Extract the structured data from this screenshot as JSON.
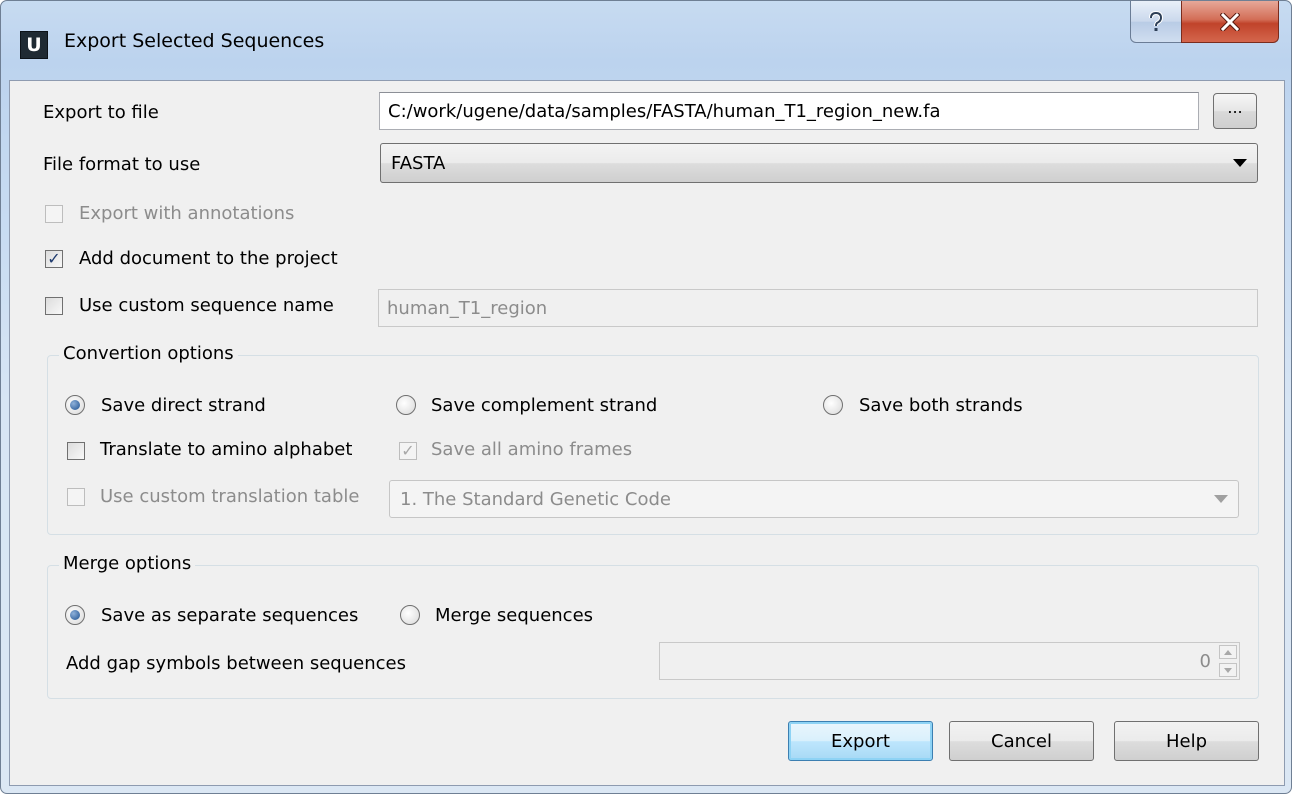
{
  "window": {
    "app_icon_letter": "U",
    "title": "Export Selected Sequences",
    "help_icon": "question-mark-icon",
    "close_icon": "close-x-icon"
  },
  "export_file": {
    "label": "Export to file",
    "value": "C:/work/ugene/data/samples/FASTA/human_T1_region_new.fa",
    "browse_label": "..."
  },
  "file_format": {
    "label": "File format to use",
    "selected": "FASTA"
  },
  "options": {
    "export_annotations": {
      "label": "Export with annotations",
      "checked": false,
      "enabled": false
    },
    "add_to_project": {
      "label": "Add document to the project",
      "checked": true,
      "enabled": true
    },
    "custom_name": {
      "label": "Use custom sequence name",
      "checked": false,
      "enabled": true,
      "value": "human_T1_region"
    }
  },
  "conversion": {
    "title": "Convertion options",
    "direct": {
      "label": "Save direct strand",
      "selected": true
    },
    "complement": {
      "label": "Save complement strand",
      "selected": false
    },
    "both": {
      "label": "Save both strands",
      "selected": false
    },
    "translate": {
      "label": "Translate to amino alphabet",
      "checked": false
    },
    "all_frames": {
      "label": "Save all amino frames",
      "checked": true,
      "enabled": false
    },
    "custom_table": {
      "label": "Use custom translation table",
      "checked": false,
      "enabled": false
    },
    "table_selected": "1. The Standard Genetic Code"
  },
  "merge": {
    "title": "Merge options",
    "separate": {
      "label": "Save as separate sequences",
      "selected": true
    },
    "merge": {
      "label": "Merge sequences",
      "selected": false
    },
    "gap_label": "Add gap symbols between sequences",
    "gap_value": "0"
  },
  "buttons": {
    "export": "Export",
    "cancel": "Cancel",
    "help": "Help"
  },
  "colors": {
    "frame": "#c7dbf1",
    "close_button": "#c0432a",
    "default_button": "#3c7fb1",
    "radio_dot": "#1c4f8f"
  }
}
